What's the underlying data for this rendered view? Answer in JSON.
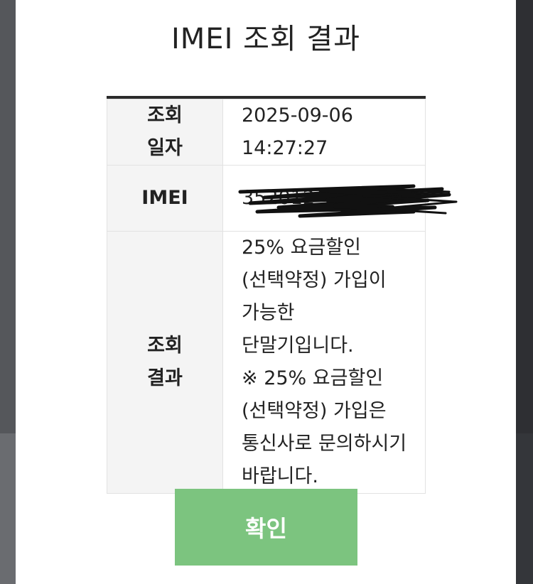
{
  "dialog": {
    "title": "IMEI 조회 결과",
    "rows": [
      {
        "label_line1": "조회",
        "label_line2": "일자",
        "value_line1": "2025-09-06",
        "value_line2": "14:27:27"
      },
      {
        "label": "IMEI",
        "value": "352012"
      },
      {
        "label_line1": "조회",
        "label_line2": "결과",
        "value": "25% 요금할인(선택약정) 가입이 가능한 단말기입니다.",
        "note": "※ 25% 요금할인(선택약정) 가입은 통신사로 문의하시기 바랍니다."
      }
    ],
    "confirm_label": "확인"
  },
  "colors": {
    "confirm_bg": "#7cc47f",
    "header_border": "#2b2b2b",
    "label_bg": "#f4f4f4"
  }
}
